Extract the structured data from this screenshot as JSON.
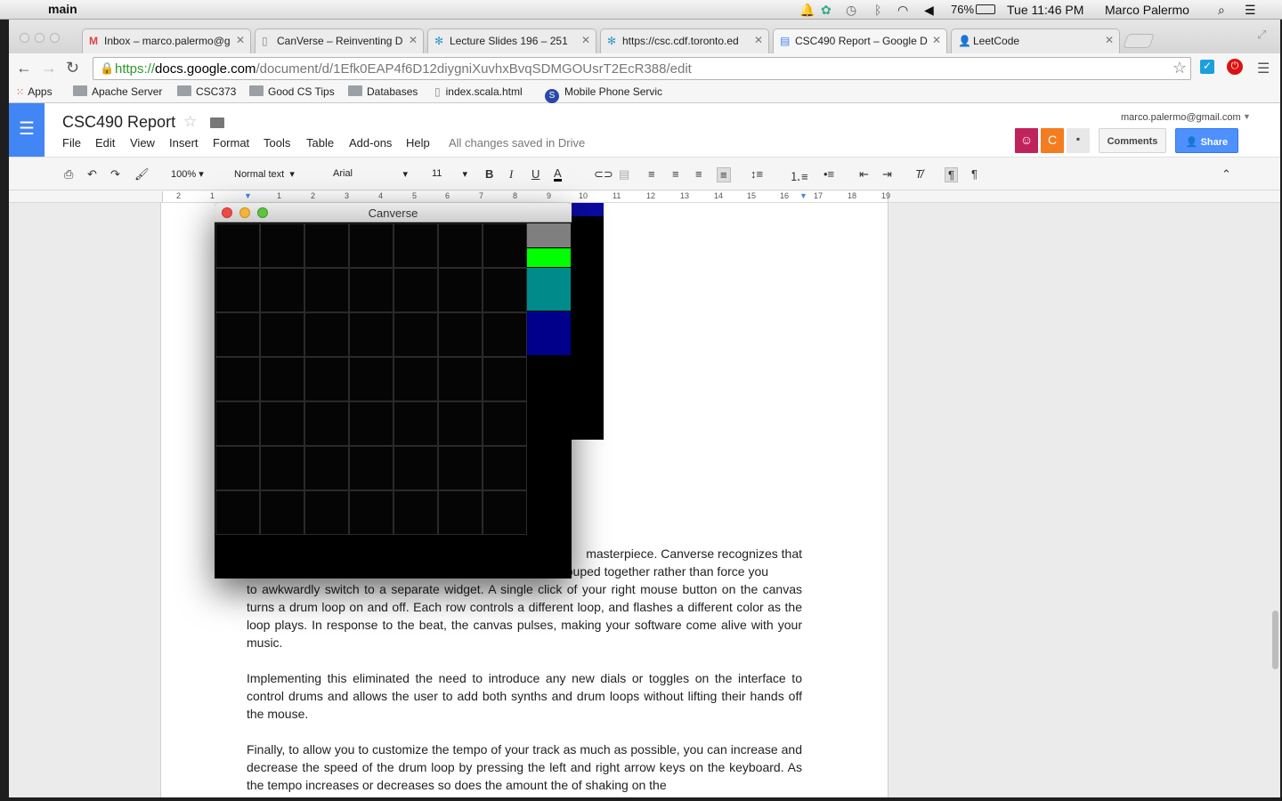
{
  "menubar": {
    "app": "main",
    "battery": "76%",
    "clock": "Tue 11:46 PM",
    "user": "Marco Palermo"
  },
  "tabs": [
    {
      "label": "Inbox – marco.palermo@g",
      "icon": "gmail-icon"
    },
    {
      "label": "CanVerse – Reinventing D",
      "icon": "document-icon"
    },
    {
      "label": "Lecture Slides 196 – 251",
      "icon": "star-favicon-icon"
    },
    {
      "label": "https://csc.cdf.toronto.ed",
      "icon": "star-favicon-icon"
    },
    {
      "label": "CSC490 Report – Google D",
      "icon": "docs-icon"
    },
    {
      "label": "LeetCode",
      "icon": "person-icon"
    }
  ],
  "url": {
    "scheme": "https://",
    "domain": "docs.google.com",
    "path": "/document/d/1Efk0EAP4f6D12diygniXuvhxBvqSDMGOUsrT2EcR388/edit"
  },
  "bookmarks": [
    {
      "label": "Apps"
    },
    {
      "label": "Apache Server"
    },
    {
      "label": "CSC373"
    },
    {
      "label": "Good CS Tips"
    },
    {
      "label": "Databases"
    },
    {
      "label": "index.scala.html"
    },
    {
      "label": "Mobile Phone Servic"
    }
  ],
  "doc": {
    "title": "CSC490 Report",
    "menus": [
      "File",
      "Edit",
      "View",
      "Insert",
      "Format",
      "Tools",
      "Table",
      "Add-ons",
      "Help"
    ],
    "saved_status": "All changes saved in Drive",
    "account": "marco.palermo@gmail.com",
    "avatar_letter": "C",
    "comments_label": "Comments",
    "share_label": "Share",
    "zoom": "100%",
    "style": "Normal text",
    "font": "Arial",
    "size": "11",
    "ruler_numbers": [
      "2",
      "1",
      "1",
      "2",
      "3",
      "4",
      "5",
      "6",
      "7",
      "8",
      "9",
      "10",
      "11",
      "12",
      "13",
      "14",
      "15",
      "16",
      "17",
      "18",
      "19"
    ],
    "para1_line1": "masterpiece. Canverse recognizes that",
    "para1_line2": "your beats and synths exist cohesively and keeps them grouped together rather than force you",
    "para1_rest": "to awkwardly switch to a separate widget. A single click of your right mouse button on the canvas turns a drum loop on and off. Each row controls a different loop, and flashes a different color as the loop plays. In response to the beat, the canvas pulses, making your software come alive with your music.",
    "para2": "Implementing this eliminated the need to introduce any new dials or toggles on the interface to control drums and allows the user to add both synths and drum loops without lifting their hands off the mouse.",
    "para3": "Finally, to allow you to customize the tempo of your track as much as possible, you can increase and decrease the speed of the drum loop by pressing the left and right arrow keys on the keyboard.  As the tempo increases or decreases so does the amount the of shaking on the"
  },
  "canverse": {
    "title": "Canverse",
    "palette": [
      {
        "color": "#7f7f7f"
      },
      {
        "color": "#00ff00"
      },
      {
        "color": "#008b8b"
      },
      {
        "color": "#00008b"
      }
    ],
    "grid_rows": 7,
    "grid_cols": 7
  }
}
